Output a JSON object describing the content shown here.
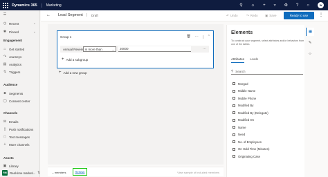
{
  "app": {
    "brand": "Dynamics 365",
    "module": "Marketing",
    "user_initials": "W"
  },
  "sidebar": {
    "top_items": [
      {
        "label": "Recent",
        "icon": "clock-icon"
      },
      {
        "label": "Pinned",
        "icon": "pin-icon"
      }
    ],
    "sections": [
      {
        "title": "Engagement",
        "items": [
          {
            "label": "Get started",
            "icon": "home-icon"
          },
          {
            "label": "Journeys",
            "icon": "journey-icon"
          },
          {
            "label": "Analytics",
            "icon": "chart-icon"
          },
          {
            "label": "Triggers",
            "icon": "lightning-icon"
          }
        ]
      },
      {
        "title": "Audience",
        "items": [
          {
            "label": "Segments",
            "icon": "people-icon"
          },
          {
            "label": "Consent center",
            "icon": "shield-icon"
          }
        ]
      },
      {
        "title": "Channels",
        "items": [
          {
            "label": "Emails",
            "icon": "mail-icon"
          },
          {
            "label": "Push notifications",
            "icon": "phone-icon"
          },
          {
            "label": "Text messages",
            "icon": "message-icon"
          },
          {
            "label": "More channels",
            "icon": "plus-icon"
          }
        ]
      },
      {
        "title": "Assets",
        "items": [
          {
            "label": "Library",
            "icon": "image-icon"
          }
        ]
      }
    ],
    "area_switcher": {
      "badge": "RM",
      "label": "Real-time marketi..."
    }
  },
  "commandbar": {
    "title": "Lead Segment",
    "status": "Draft",
    "undo": "Undo",
    "redo": "Redo",
    "save": "Save",
    "ready": "Ready to use"
  },
  "builder": {
    "group_label": "Group 1",
    "condition": {
      "attribute": "Annual Revenue",
      "operator": "is more than",
      "value": "20000"
    },
    "add_subgroup": "Add a subgroup",
    "add_group": "Add a new group"
  },
  "footer": {
    "members": "-- members",
    "refresh": "Refresh",
    "view_sample": "View sample of included members"
  },
  "elements_panel": {
    "title": "Elements",
    "description": "To construct your segment, select attributes and/or behaviors from one of the tables",
    "tabs": [
      "Attributes",
      "Leads"
    ],
    "search_placeholder": "Search",
    "attributes": [
      "Merged",
      "Middle Name",
      "Mobile Phone",
      "Modified By",
      "Modified By (Delegate)",
      "Modified On",
      "Name",
      "Need",
      "No. of Employees",
      "On Hold Time (Minutes)",
      "Originating Case"
    ]
  }
}
